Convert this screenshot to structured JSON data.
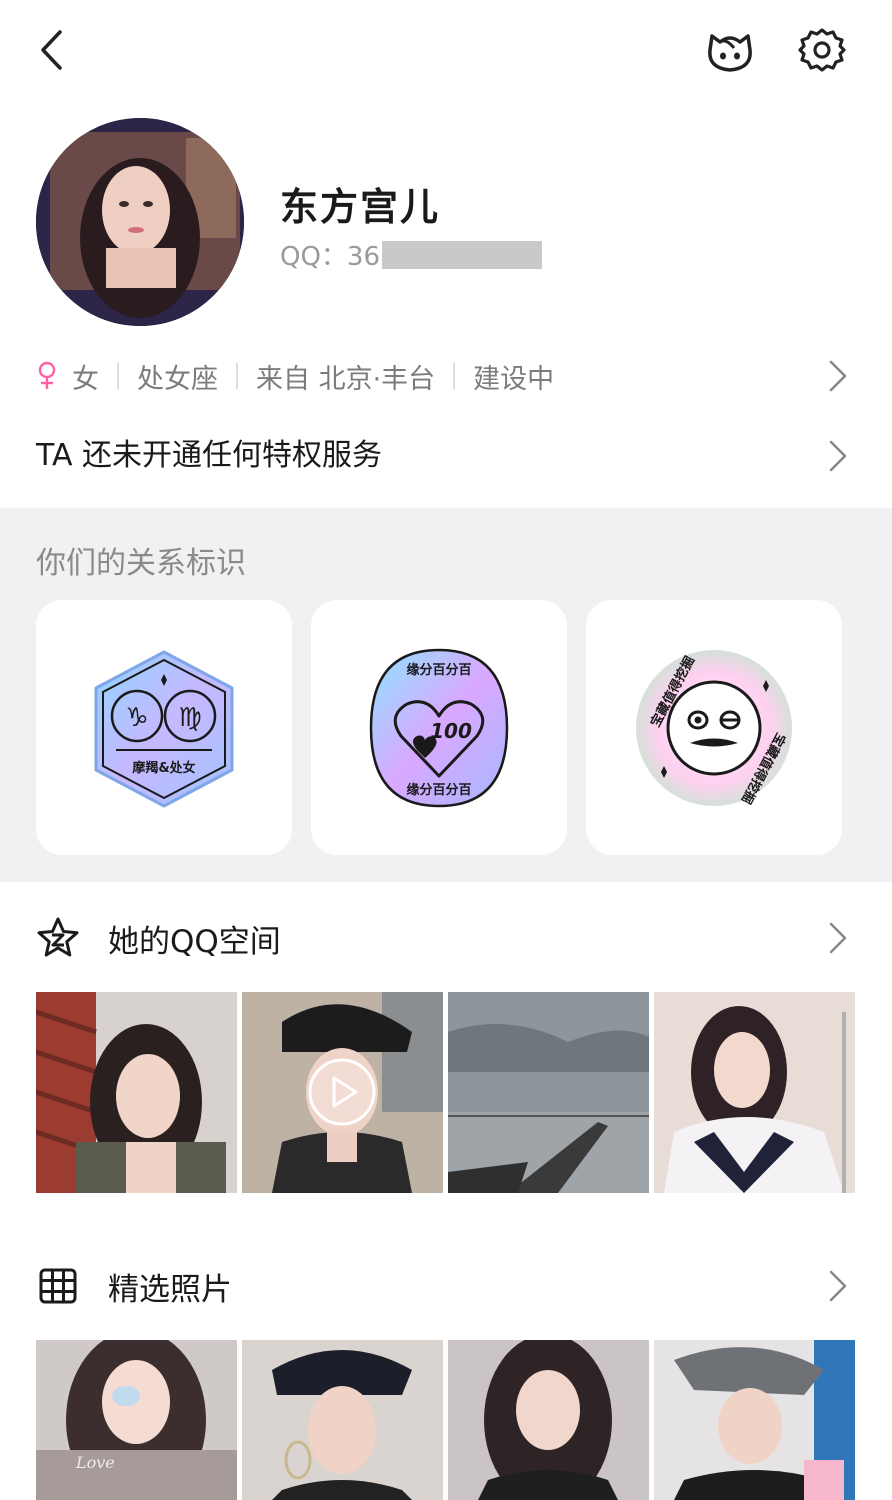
{
  "profile": {
    "nickname": "东方宫儿",
    "qq_prefix": "QQ：36"
  },
  "info": {
    "gender": "女",
    "zodiac": "处女座",
    "location": "来自 北京·丰台",
    "status": "建设中"
  },
  "privilege_text": "TA 还未开通任何特权服务",
  "relationship": {
    "title": "你们的关系标识",
    "badges": [
      {
        "caption": "摩羯&处女",
        "icon": "zodiac-badge-icon"
      },
      {
        "caption_top": "缘分百分百",
        "caption_bottom": "缘分百分百",
        "value": "100",
        "icon": "heart-100-badge-icon"
      },
      {
        "caption_top": "宝藏值得挖掘",
        "caption_bottom": "宝藏值得挖掘",
        "icon": "treasure-face-badge-icon"
      }
    ]
  },
  "qzone": {
    "title": "她的QQ空间",
    "icon": "qzone-star-icon"
  },
  "photos": {
    "title": "精选照片",
    "icon": "grid-icon"
  },
  "colors": {
    "female_pink": "#ff5fa2",
    "section_bg": "#f1f1f4",
    "secondary_text": "#7c7c7c"
  }
}
